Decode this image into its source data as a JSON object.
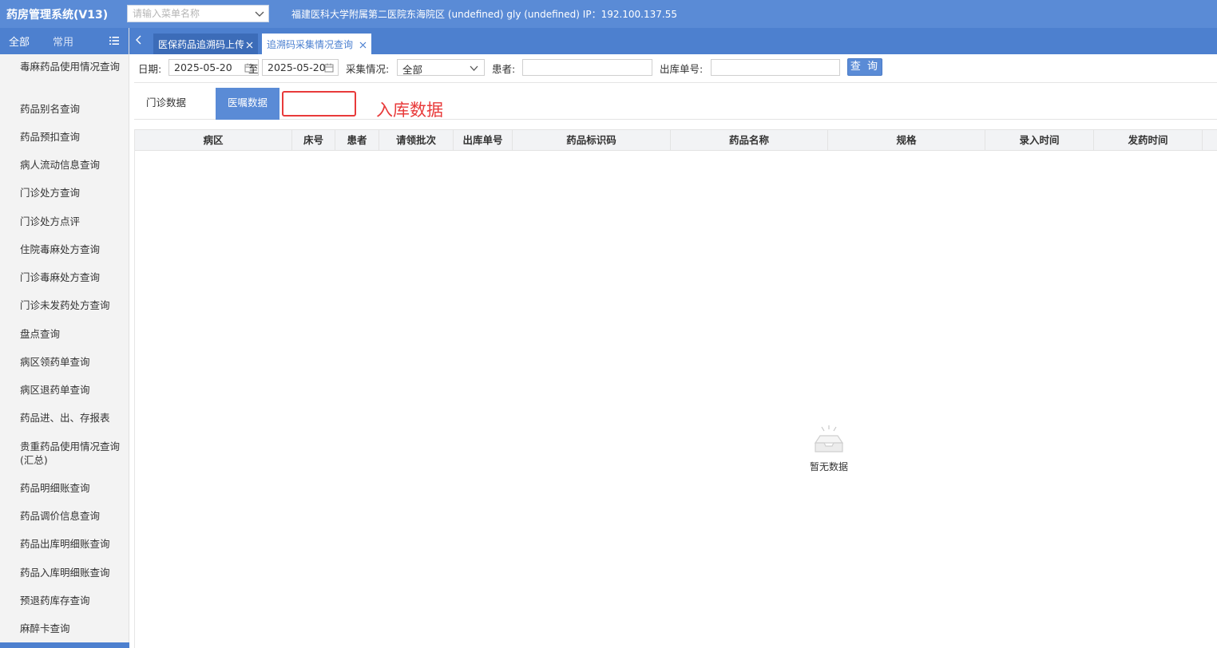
{
  "app": {
    "title": "药房管理系统(V13)",
    "menu_search_placeholder": "请输入菜单名称",
    "info": "福建医科大学附属第二医院东海院区 (undefined) gly (undefined) IP：192.100.137.55"
  },
  "sidebar": {
    "tab_all": "全部",
    "tab_common": "常用",
    "items": [
      "毒麻药品使用情况查询",
      "药品别名查询",
      "药品预扣查询",
      "病人流动信息查询",
      "门诊处方查询",
      "门诊处方点评",
      "住院毒麻处方查询",
      "门诊毒麻处方查询",
      "门诊未发药处方查询",
      "盘点查询",
      "病区领药单查询",
      "病区退药单查询",
      "药品进、出、存报表",
      "贵重药品使用情况查询(汇总)",
      "药品明细账查询",
      "药品调价信息查询",
      "药品出库明细账查询",
      "药品入库明细账查询",
      "预退药库存查询",
      "麻醉卡查询"
    ]
  },
  "tabs": [
    {
      "label": "医保药品追溯码上传"
    },
    {
      "label": "追溯码采集情况查询"
    }
  ],
  "filters": {
    "date_label": "日期:",
    "date_from": "2025-05-20",
    "to_label": "至",
    "date_to": "2025-05-20",
    "collect_label": "采集情况:",
    "collect_value": "全部",
    "patient_label": "患者:",
    "patient_value": "",
    "outbound_label": "出库单号:",
    "outbound_value": "",
    "query_button": "查 询"
  },
  "subtabs": {
    "outpatient": "门诊数据",
    "ward": "医嘱数据",
    "annotation": "入库数据"
  },
  "grid": {
    "columns": [
      "病区",
      "床号",
      "患者",
      "请领批次",
      "出库单号",
      "药品标识码",
      "药品名称",
      "规格",
      "录入时间",
      "发药时间"
    ],
    "empty_text": "暂无数据"
  },
  "colors": {
    "header_bg": "#5a8bd6",
    "sidebar_tab_bg": "#4d80cf",
    "active_tab_bg": "#3c6cb8",
    "annotation_red": "#e83a3a"
  }
}
